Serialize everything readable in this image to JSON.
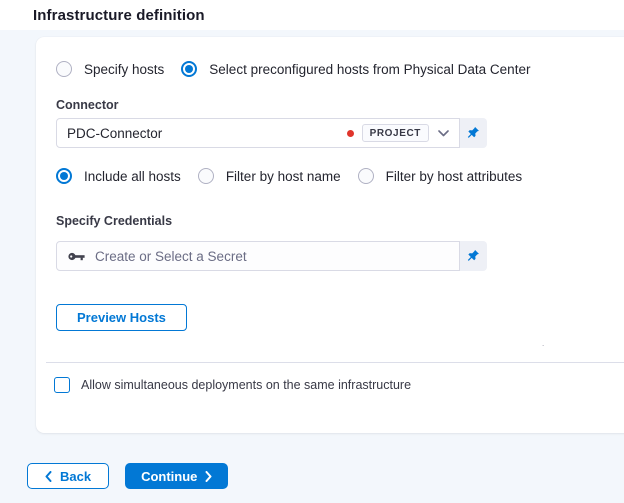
{
  "header": {
    "title": "Infrastructure definition"
  },
  "host_source_options": [
    {
      "label": "Specify hosts",
      "selected": false
    },
    {
      "label": "Select preconfigured hosts from Physical Data Center",
      "selected": true
    }
  ],
  "connector": {
    "label": "Connector",
    "value": "PDC-Connector",
    "scope_badge": "PROJECT"
  },
  "host_filter_options": [
    {
      "label": "Include all hosts",
      "selected": true
    },
    {
      "label": "Filter by host name",
      "selected": false
    },
    {
      "label": "Filter by host attributes",
      "selected": false
    }
  ],
  "credentials": {
    "label": "Specify Credentials",
    "placeholder": "Create or Select a Secret"
  },
  "buttons": {
    "preview_hosts": "Preview Hosts",
    "back": "Back",
    "continue": "Continue"
  },
  "checkbox": {
    "label": "Allow simultaneous deployments on the same infrastructure",
    "checked": false
  },
  "artifacts": {
    "stray_mark": "."
  },
  "colors": {
    "primary": "#0278d5",
    "connector_status_dot": "#e0352b",
    "page_background": "#f3f7fc",
    "border": "#d9dae5"
  }
}
